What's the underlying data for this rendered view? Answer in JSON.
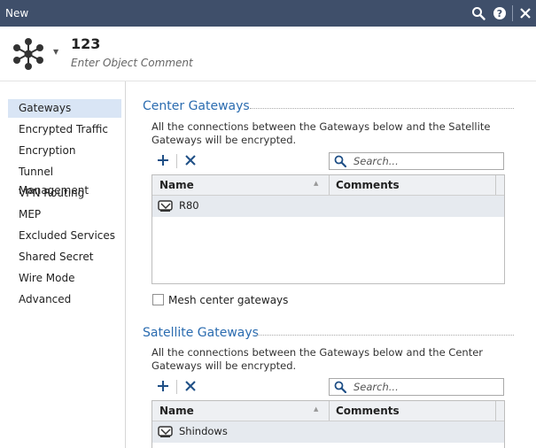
{
  "window": {
    "title": "New"
  },
  "object": {
    "name": "123",
    "comment_placeholder": "Enter Object Comment"
  },
  "sidebar": {
    "items": [
      {
        "label": "Gateways",
        "active": true
      },
      {
        "label": "Encrypted Traffic"
      },
      {
        "label": "Encryption"
      },
      {
        "label": "Tunnel Management"
      },
      {
        "label": "VPN Routing"
      },
      {
        "label": "MEP"
      },
      {
        "label": "Excluded Services"
      },
      {
        "label": "Shared Secret"
      },
      {
        "label": "Wire Mode"
      },
      {
        "label": "Advanced"
      }
    ]
  },
  "center": {
    "title": "Center Gateways",
    "description": "All the connections between the Gateways below and the Satellite Gateways will be encrypted.",
    "search_placeholder": "Search...",
    "columns": [
      "Name",
      "Comments"
    ],
    "rows": [
      {
        "name": "R80",
        "comments": ""
      }
    ],
    "mesh_label": "Mesh center gateways",
    "mesh_checked": false
  },
  "satellite": {
    "title": "Satellite Gateways",
    "description": "All the connections between the Gateways below and the Center Gateways will be encrypted.",
    "search_placeholder": "Search...",
    "columns": [
      "Name",
      "Comments"
    ],
    "rows": [
      {
        "name": "Shindows",
        "comments": ""
      }
    ]
  },
  "colors": {
    "titlebar": "#3f4f6a",
    "accent": "#2b6cb0",
    "selection": "#d9e5f5"
  }
}
